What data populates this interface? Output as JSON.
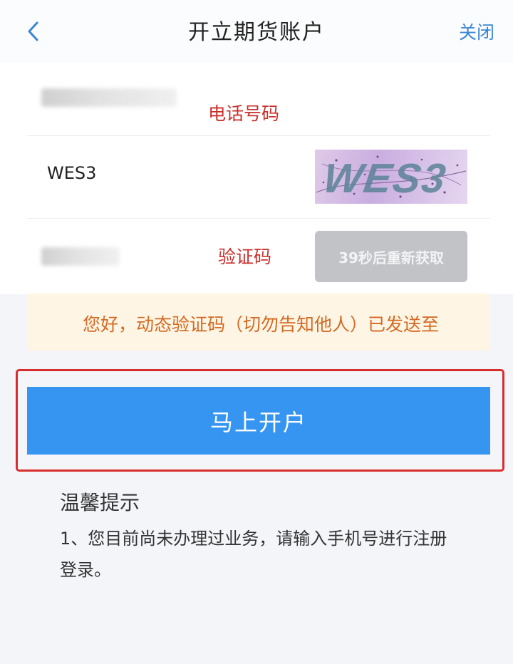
{
  "header": {
    "title": "开立期货账户",
    "close_label": "关闭",
    "back_icon": "chevron-left-icon"
  },
  "form": {
    "phone": {
      "annotation": "电话号码"
    },
    "captcha": {
      "value": "WES3",
      "image_text": "WES3"
    },
    "sms": {
      "annotation": "验证码",
      "send_button_label": "39秒后重新获取"
    }
  },
  "notice": {
    "text": "您好，动态验证码（切勿告知他人）已发送至"
  },
  "main_button_label": "马上开户",
  "tips": {
    "title": "温馨提示",
    "body": "1、您目前尚未办理过业务，请输入手机号进行注册登录。"
  },
  "colors": {
    "accent": "#3795f2",
    "link": "#3a86d4",
    "annotation": "#c9302c",
    "notice_text": "#d26a24"
  }
}
